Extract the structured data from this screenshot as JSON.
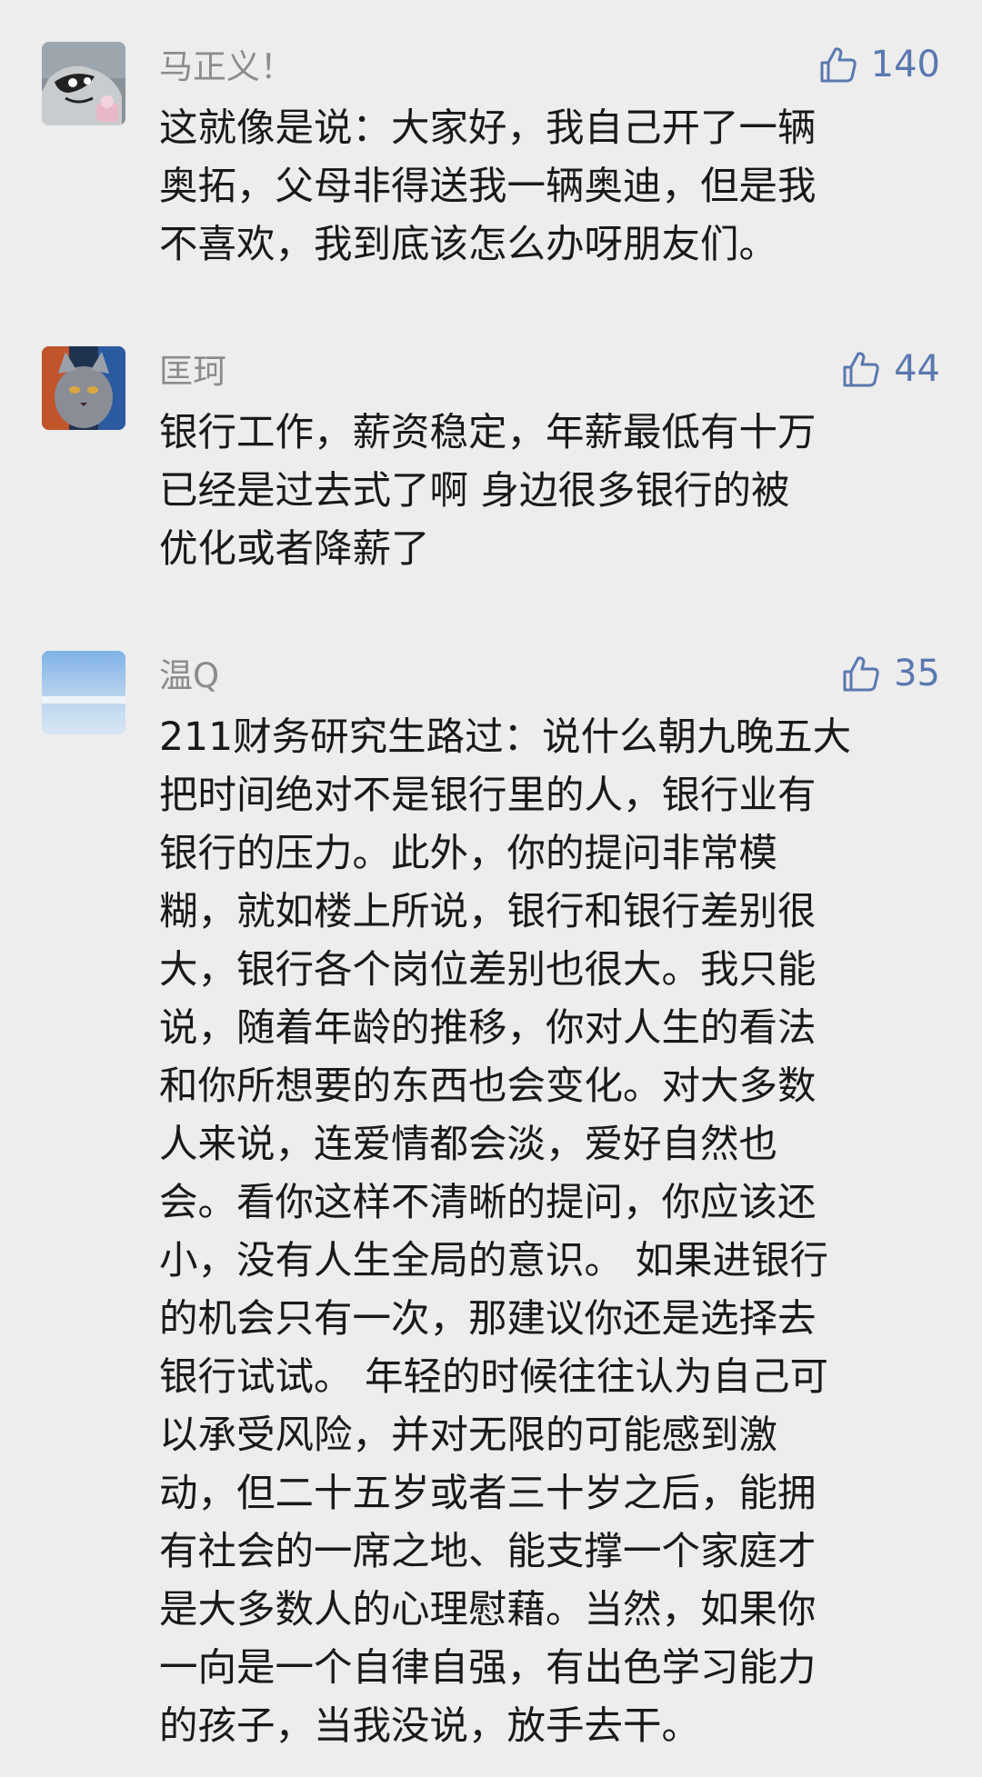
{
  "comments": [
    {
      "nickname": "马正义！",
      "likes": "140",
      "avatar_icon": "raccoon-cartoon-avatar",
      "text": "这就像是说：大家好，我自己开了一辆\n奥拓，父母非得送我一辆奥迪，但是我\n不喜欢，我到底该怎么办呀朋友们。"
    },
    {
      "nickname": "匡珂",
      "likes": "44",
      "avatar_icon": "cat-photo-avatar",
      "text": "银行工作，薪资稳定，年薪最低有十万\n已经是过去式了啊    身边很多银行的被\n优化或者降薪了"
    },
    {
      "nickname": "温Q",
      "likes": "35",
      "avatar_icon": "sky-photo-avatar",
      "text": "211财务研究生路过：说什么朝九晚五大\n把时间绝对不是银行里的人，银行业有\n银行的压力。此外，你的提问非常模\n糊，就如楼上所说，银行和银行差别很\n大，银行各个岗位差别也很大。我只能\n说，随着年龄的推移，你对人生的看法\n和你所想要的东西也会变化。对大多数\n人来说，连爱情都会淡，爱好自然也\n会。看你这样不清晰的提问，你应该还\n小，没有人生全局的意识。 如果进银行\n的机会只有一次，那建议你还是选择去\n银行试试。 年轻的时候往往认为自己可\n以承受风险，并对无限的可能感到激\n动，但二十五岁或者三十岁之后，能拥\n有社会的一席之地、能支撑一个家庭才\n是大多数人的心理慰藉。当然，如果你\n一向是一个自律自强，有出色学习能力\n的孩子，当我没说，放手去干。"
    }
  ],
  "colors": {
    "background": "#ededed",
    "nickname": "#8c8c8c",
    "like": "#5a78b0",
    "text": "#191919"
  }
}
